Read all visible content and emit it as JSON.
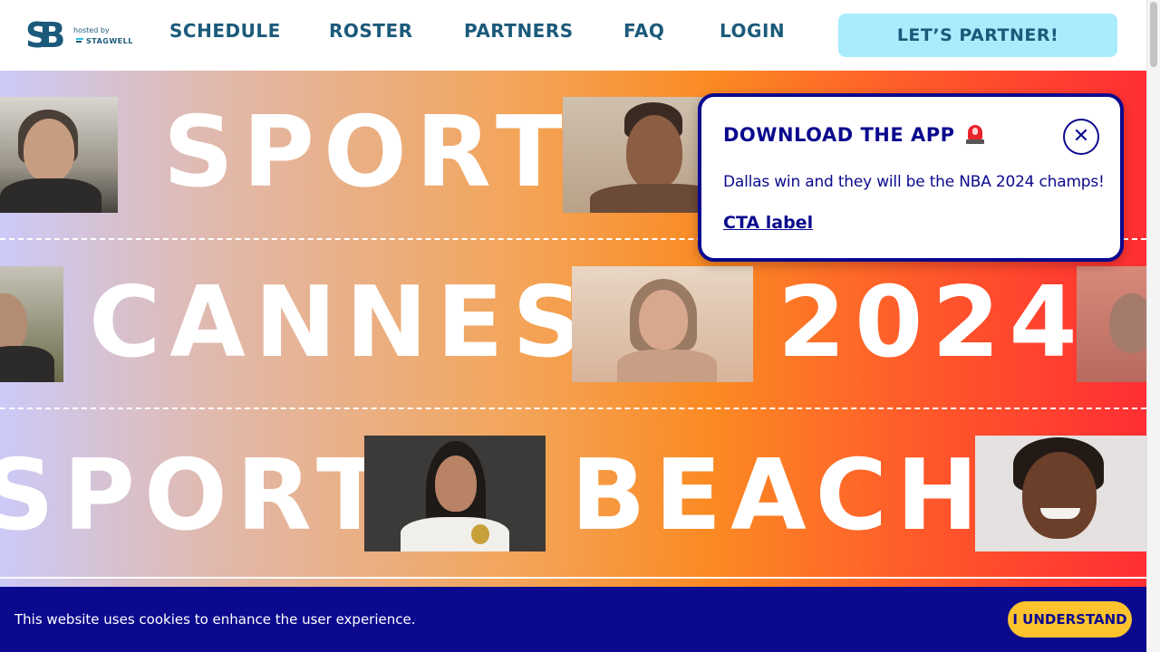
{
  "header": {
    "logo": {
      "mark": "SB",
      "hosted_by": "hosted by",
      "host_name": "STAGWELL"
    },
    "nav": {
      "schedule": "SCHEDULE",
      "roster": "ROSTER",
      "partners": "PARTNERS",
      "faq": "FAQ",
      "login": "LOGIN"
    },
    "cta_label": "LET’S PARTNER!"
  },
  "hero": {
    "rows": [
      {
        "words": [
          "SPORT"
        ]
      },
      {
        "words": [
          "CANNES",
          "2024"
        ]
      },
      {
        "words": [
          "SPORT",
          "BEACH"
        ]
      }
    ]
  },
  "popup": {
    "title": "DOWNLOAD THE APP",
    "title_icon": "siren-icon",
    "close_icon": "close-icon",
    "close_glyph": "✕",
    "body": "Dallas win and they will be the NBA 2024 champs!",
    "link_label": "CTA label"
  },
  "cookie_banner": {
    "text": "This website uses cookies to enhance the user experience.",
    "button_label": "I UNDERSTAND"
  },
  "colors": {
    "brand_blue": "#1b5a7a",
    "accent_cyan": "#a9ecfc",
    "popup_navy": "#0b0a8e",
    "cookie_yellow": "#fcc32f",
    "gradient_start": "#cccaf8",
    "gradient_mid": "#fb8a23",
    "gradient_end": "#ff2e33"
  }
}
